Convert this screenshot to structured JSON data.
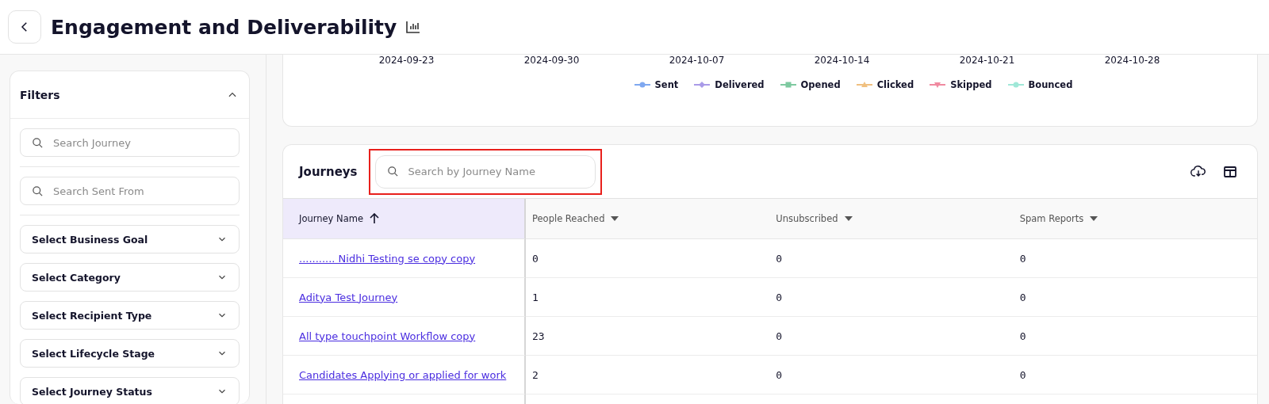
{
  "header": {
    "title": "Engagement and Deliverability"
  },
  "filters": {
    "title": "Filters",
    "expanded": true,
    "searches": [
      {
        "placeholder": "Search Journey"
      },
      {
        "placeholder": "Search Sent From"
      }
    ],
    "selects": [
      "Select Business Goal",
      "Select Category",
      "Select Recipient Type",
      "Select Lifecycle Stage",
      "Select Journey Status"
    ]
  },
  "chart": {
    "x_labels": [
      "2024-09-23",
      "2024-09-30",
      "2024-10-07",
      "2024-10-14",
      "2024-10-21",
      "2024-10-28"
    ],
    "legend": [
      {
        "label": "Sent",
        "color": "#7fa8f0",
        "kind": "circle"
      },
      {
        "label": "Delivered",
        "color": "#a99be8",
        "kind": "diamond"
      },
      {
        "label": "Opened",
        "color": "#7ec9a0",
        "kind": "square"
      },
      {
        "label": "Clicked",
        "color": "#f0c080",
        "kind": "triangle"
      },
      {
        "label": "Skipped",
        "color": "#f08aa0",
        "kind": "down"
      },
      {
        "label": "Bounced",
        "color": "#a0e8d8",
        "kind": "circle"
      }
    ]
  },
  "journeys": {
    "title": "Journeys",
    "search": {
      "placeholder": "Search by Journey Name",
      "highlighted": true
    },
    "columns": [
      {
        "label": "Journey Name",
        "kind": "sorted",
        "selected": true
      },
      {
        "label": "People Reached",
        "kind": "menu",
        "selected": false
      },
      {
        "label": "Unsubscribed",
        "kind": "menu",
        "selected": false
      },
      {
        "label": "Spam Reports",
        "kind": "menu",
        "selected": false
      }
    ],
    "rows": [
      [
        "........... Nidhi Testing se copy copy",
        "0",
        "0",
        "0"
      ],
      [
        "Aditya Test Journey",
        "1",
        "0",
        "0"
      ],
      [
        "All type touchpoint Workflow copy",
        "23",
        "0",
        "0"
      ],
      [
        "Candidates Applying or applied for work",
        "2",
        "0",
        "0"
      ]
    ]
  }
}
